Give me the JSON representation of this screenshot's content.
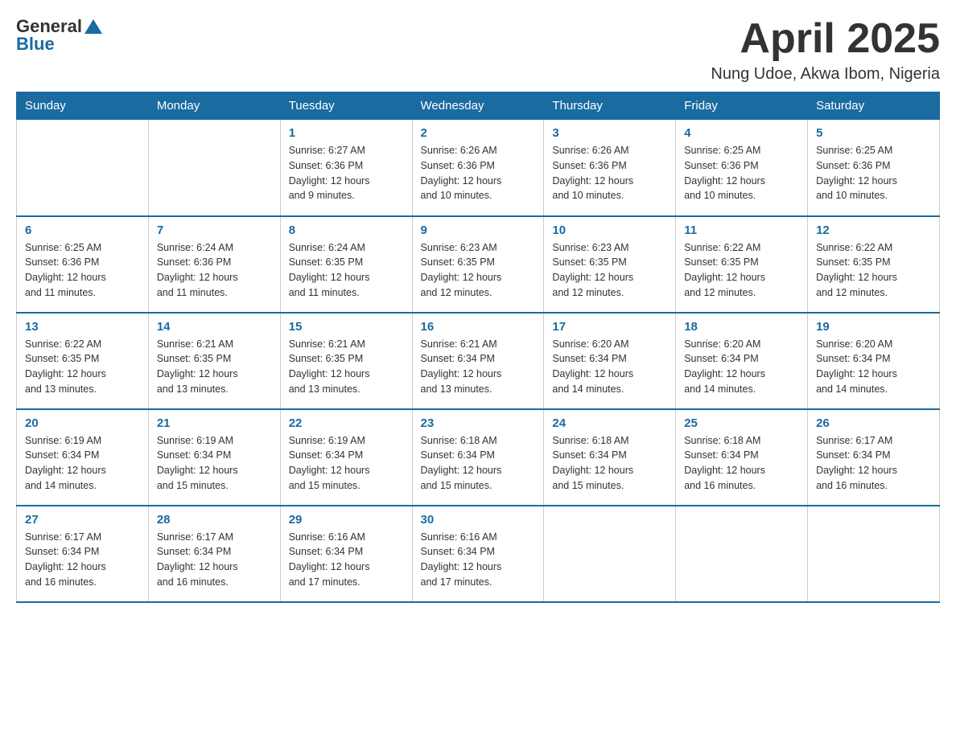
{
  "header": {
    "logo_text_general": "General",
    "logo_text_blue": "Blue",
    "month_title": "April 2025",
    "location": "Nung Udoe, Akwa Ibom, Nigeria"
  },
  "days_of_week": [
    "Sunday",
    "Monday",
    "Tuesday",
    "Wednesday",
    "Thursday",
    "Friday",
    "Saturday"
  ],
  "weeks": [
    [
      {
        "day": "",
        "info": ""
      },
      {
        "day": "",
        "info": ""
      },
      {
        "day": "1",
        "info": "Sunrise: 6:27 AM\nSunset: 6:36 PM\nDaylight: 12 hours\nand 9 minutes."
      },
      {
        "day": "2",
        "info": "Sunrise: 6:26 AM\nSunset: 6:36 PM\nDaylight: 12 hours\nand 10 minutes."
      },
      {
        "day": "3",
        "info": "Sunrise: 6:26 AM\nSunset: 6:36 PM\nDaylight: 12 hours\nand 10 minutes."
      },
      {
        "day": "4",
        "info": "Sunrise: 6:25 AM\nSunset: 6:36 PM\nDaylight: 12 hours\nand 10 minutes."
      },
      {
        "day": "5",
        "info": "Sunrise: 6:25 AM\nSunset: 6:36 PM\nDaylight: 12 hours\nand 10 minutes."
      }
    ],
    [
      {
        "day": "6",
        "info": "Sunrise: 6:25 AM\nSunset: 6:36 PM\nDaylight: 12 hours\nand 11 minutes."
      },
      {
        "day": "7",
        "info": "Sunrise: 6:24 AM\nSunset: 6:36 PM\nDaylight: 12 hours\nand 11 minutes."
      },
      {
        "day": "8",
        "info": "Sunrise: 6:24 AM\nSunset: 6:35 PM\nDaylight: 12 hours\nand 11 minutes."
      },
      {
        "day": "9",
        "info": "Sunrise: 6:23 AM\nSunset: 6:35 PM\nDaylight: 12 hours\nand 12 minutes."
      },
      {
        "day": "10",
        "info": "Sunrise: 6:23 AM\nSunset: 6:35 PM\nDaylight: 12 hours\nand 12 minutes."
      },
      {
        "day": "11",
        "info": "Sunrise: 6:22 AM\nSunset: 6:35 PM\nDaylight: 12 hours\nand 12 minutes."
      },
      {
        "day": "12",
        "info": "Sunrise: 6:22 AM\nSunset: 6:35 PM\nDaylight: 12 hours\nand 12 minutes."
      }
    ],
    [
      {
        "day": "13",
        "info": "Sunrise: 6:22 AM\nSunset: 6:35 PM\nDaylight: 12 hours\nand 13 minutes."
      },
      {
        "day": "14",
        "info": "Sunrise: 6:21 AM\nSunset: 6:35 PM\nDaylight: 12 hours\nand 13 minutes."
      },
      {
        "day": "15",
        "info": "Sunrise: 6:21 AM\nSunset: 6:35 PM\nDaylight: 12 hours\nand 13 minutes."
      },
      {
        "day": "16",
        "info": "Sunrise: 6:21 AM\nSunset: 6:34 PM\nDaylight: 12 hours\nand 13 minutes."
      },
      {
        "day": "17",
        "info": "Sunrise: 6:20 AM\nSunset: 6:34 PM\nDaylight: 12 hours\nand 14 minutes."
      },
      {
        "day": "18",
        "info": "Sunrise: 6:20 AM\nSunset: 6:34 PM\nDaylight: 12 hours\nand 14 minutes."
      },
      {
        "day": "19",
        "info": "Sunrise: 6:20 AM\nSunset: 6:34 PM\nDaylight: 12 hours\nand 14 minutes."
      }
    ],
    [
      {
        "day": "20",
        "info": "Sunrise: 6:19 AM\nSunset: 6:34 PM\nDaylight: 12 hours\nand 14 minutes."
      },
      {
        "day": "21",
        "info": "Sunrise: 6:19 AM\nSunset: 6:34 PM\nDaylight: 12 hours\nand 15 minutes."
      },
      {
        "day": "22",
        "info": "Sunrise: 6:19 AM\nSunset: 6:34 PM\nDaylight: 12 hours\nand 15 minutes."
      },
      {
        "day": "23",
        "info": "Sunrise: 6:18 AM\nSunset: 6:34 PM\nDaylight: 12 hours\nand 15 minutes."
      },
      {
        "day": "24",
        "info": "Sunrise: 6:18 AM\nSunset: 6:34 PM\nDaylight: 12 hours\nand 15 minutes."
      },
      {
        "day": "25",
        "info": "Sunrise: 6:18 AM\nSunset: 6:34 PM\nDaylight: 12 hours\nand 16 minutes."
      },
      {
        "day": "26",
        "info": "Sunrise: 6:17 AM\nSunset: 6:34 PM\nDaylight: 12 hours\nand 16 minutes."
      }
    ],
    [
      {
        "day": "27",
        "info": "Sunrise: 6:17 AM\nSunset: 6:34 PM\nDaylight: 12 hours\nand 16 minutes."
      },
      {
        "day": "28",
        "info": "Sunrise: 6:17 AM\nSunset: 6:34 PM\nDaylight: 12 hours\nand 16 minutes."
      },
      {
        "day": "29",
        "info": "Sunrise: 6:16 AM\nSunset: 6:34 PM\nDaylight: 12 hours\nand 17 minutes."
      },
      {
        "day": "30",
        "info": "Sunrise: 6:16 AM\nSunset: 6:34 PM\nDaylight: 12 hours\nand 17 minutes."
      },
      {
        "day": "",
        "info": ""
      },
      {
        "day": "",
        "info": ""
      },
      {
        "day": "",
        "info": ""
      }
    ]
  ]
}
